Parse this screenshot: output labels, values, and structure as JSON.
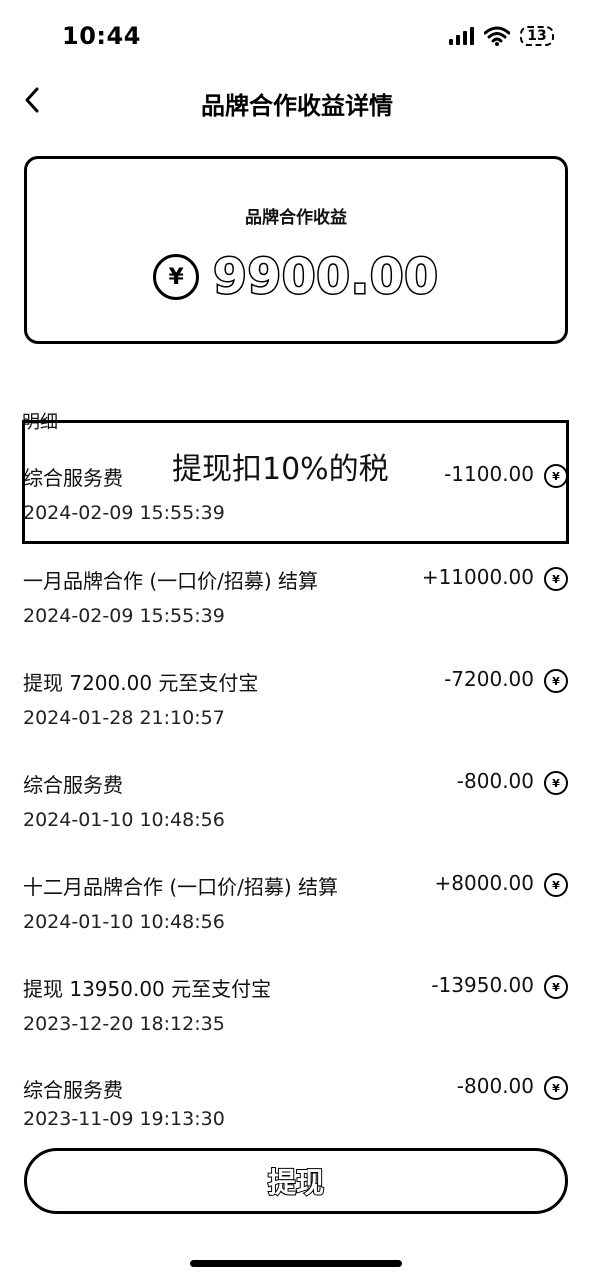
{
  "status_bar": {
    "time": "10:44",
    "battery": "13"
  },
  "nav": {
    "title": "品牌合作收益详情"
  },
  "balance": {
    "label": "品牌合作收益",
    "currency_symbol": "¥",
    "amount": "9900.00"
  },
  "detail_label": "明细",
  "annotation": {
    "text": "提现扣10%的税"
  },
  "transactions": [
    {
      "title": "综合服务费",
      "time": "2024-02-09 15:55:39",
      "amount": "-1100.00",
      "coin": "¥"
    },
    {
      "title": "一月品牌合作 (一口价/招募) 结算",
      "time": "2024-02-09 15:55:39",
      "amount": "+11000.00",
      "coin": "¥"
    },
    {
      "title": "提现 7200.00 元至支付宝",
      "time": "2024-01-28 21:10:57",
      "amount": "-7200.00",
      "coin": "¥"
    },
    {
      "title": "综合服务费",
      "time": "2024-01-10 10:48:56",
      "amount": "-800.00",
      "coin": "¥"
    },
    {
      "title": "十二月品牌合作 (一口价/招募) 结算",
      "time": "2024-01-10 10:48:56",
      "amount": "+8000.00",
      "coin": "¥"
    },
    {
      "title": "提现 13950.00 元至支付宝",
      "time": "2023-12-20 18:12:35",
      "amount": "-13950.00",
      "coin": "¥"
    },
    {
      "title": "综合服务费",
      "time": "2023-11-09 19:13:30",
      "amount": "-800.00",
      "coin": "¥"
    }
  ],
  "withdraw_button": {
    "label": "提现"
  },
  "icons": {
    "back": "chevron-left-icon",
    "coin": "yuan-coin-icon",
    "signal": "signal-icon",
    "wifi": "wifi-icon",
    "battery": "battery-icon"
  }
}
